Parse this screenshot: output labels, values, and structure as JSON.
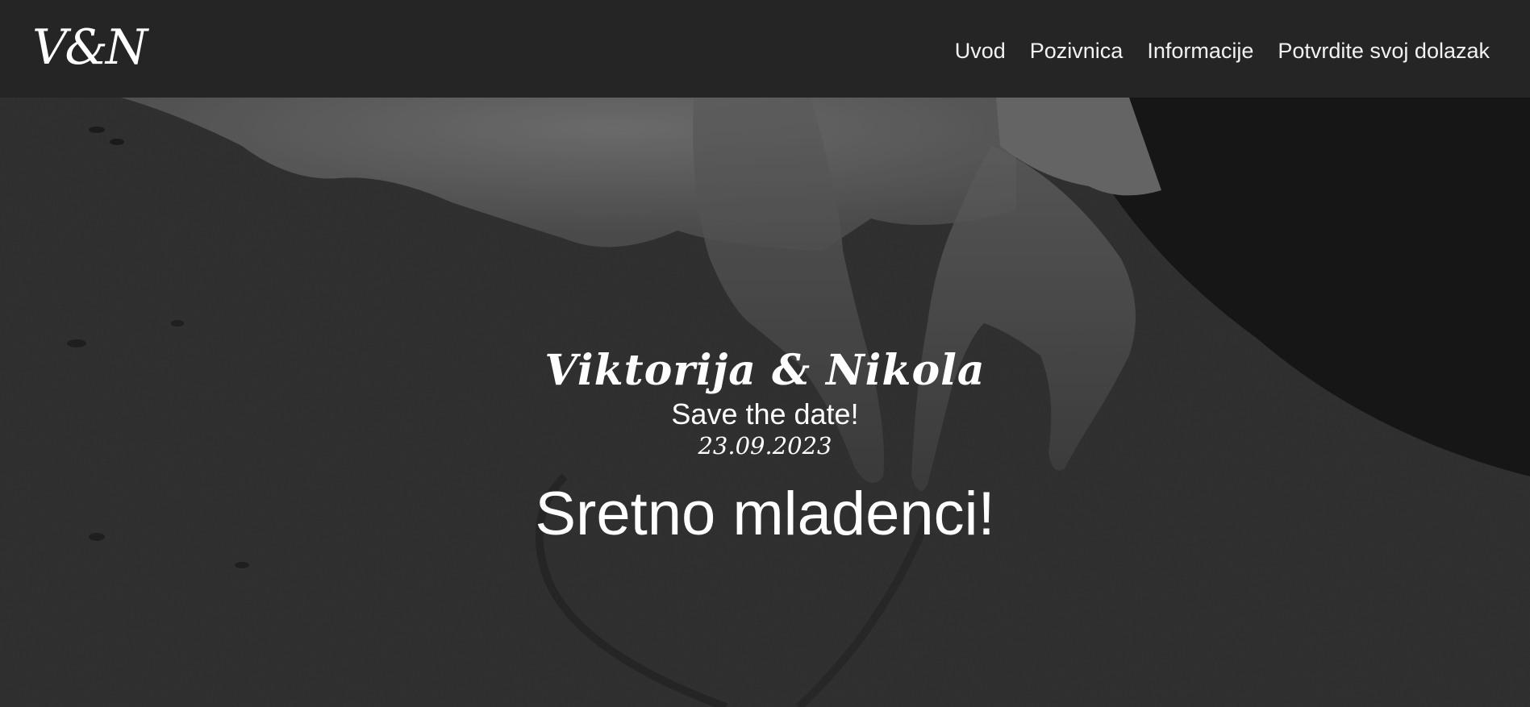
{
  "nav": {
    "brand": "V&N",
    "links": [
      "Uvod",
      "Pozivnica",
      "Informacije",
      "Potvrdite svoj dolazak"
    ]
  },
  "hero": {
    "couple": "Viktorija & Nikola",
    "save_the_date": "Save the date!",
    "date": "23.09.2023",
    "congrats": "Sretno mladenci!"
  },
  "colors": {
    "navbar": "#252525",
    "text": "#ffffff"
  }
}
